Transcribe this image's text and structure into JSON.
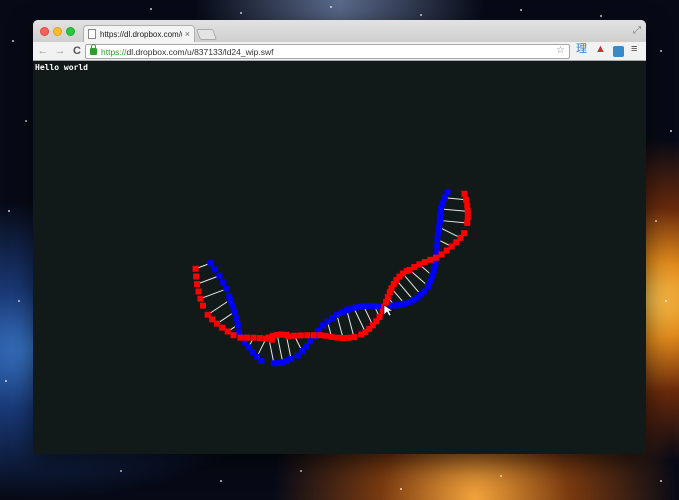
{
  "browser": {
    "tab": {
      "title": "https://dl.dropbox.com/u/8",
      "close_glyph": "×",
      "favicon": "page-icon"
    },
    "toolbar": {
      "back_glyph": "←",
      "forward_glyph": "→",
      "reload_glyph": "C",
      "url_scheme": "https://",
      "url_rest": "dl.dropbox.com/u/837133/ld24_wip.swf",
      "bookmark_glyph": "☆",
      "extensions": [
        {
          "name": "dictionary-extension-icon",
          "glyph": "理",
          "color": "#3b78c8"
        },
        {
          "name": "turtle-extension-icon",
          "glyph": "▲",
          "color": "#d03030"
        },
        {
          "name": "blue-extension-icon",
          "glyph": "",
          "color": "#3a8ac8"
        }
      ],
      "menu_glyph": "≡"
    }
  },
  "content": {
    "background_color": "#121a19",
    "label": "Hello world"
  },
  "helix": {
    "strand_colors": {
      "a": "#ff0000",
      "b": "#0000ff",
      "rungs": "#e8e8e8"
    }
  }
}
